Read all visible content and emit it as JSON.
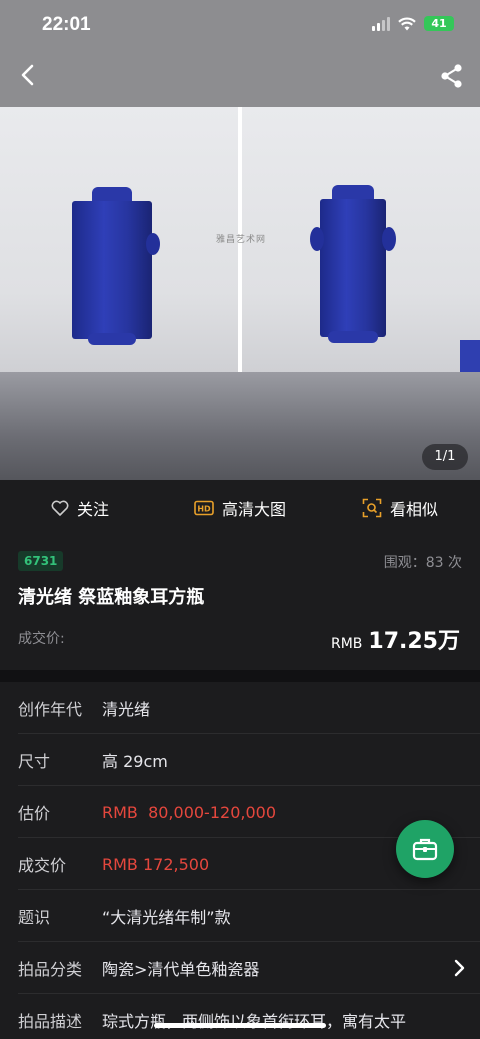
{
  "status_bar": {
    "time": "22:01",
    "battery": "41"
  },
  "hero": {
    "watermark": "雅昌艺术网",
    "page_indicator": "1/1"
  },
  "actions": [
    {
      "label": "关注",
      "icon": "heart-outline-icon"
    },
    {
      "label": "高清大图",
      "icon": "hd-icon"
    },
    {
      "label": "看相似",
      "icon": "scan-search-icon"
    }
  ],
  "summary": {
    "lot_number": "6731",
    "views": "围观：83 次",
    "title": "清光绪 祭蓝釉象耳方瓶",
    "deal_label": "成交价:",
    "deal_currency": "RMB",
    "deal_amount": "17.25万"
  },
  "details": [
    {
      "key": "创作年代",
      "value": "清光绪"
    },
    {
      "key": "尺寸",
      "value": "高 29cm"
    },
    {
      "key": "估价",
      "value": "RMB  80,000-120,000"
    },
    {
      "key": "成交价",
      "value": "RMB 172,500"
    },
    {
      "key": "题识",
      "value": "“大清光绪年制”款"
    },
    {
      "key": "拍品分类",
      "value": "陶瓷>清代单色釉瓷器"
    },
    {
      "key": "拍品描述",
      "value": "琮式方瓶，两侧饰以象首衔环耳，寓有太平"
    }
  ],
  "colors": {
    "accent_green": "#1fa366",
    "price_red": "#e5473d",
    "background": "#1c1c1e"
  }
}
